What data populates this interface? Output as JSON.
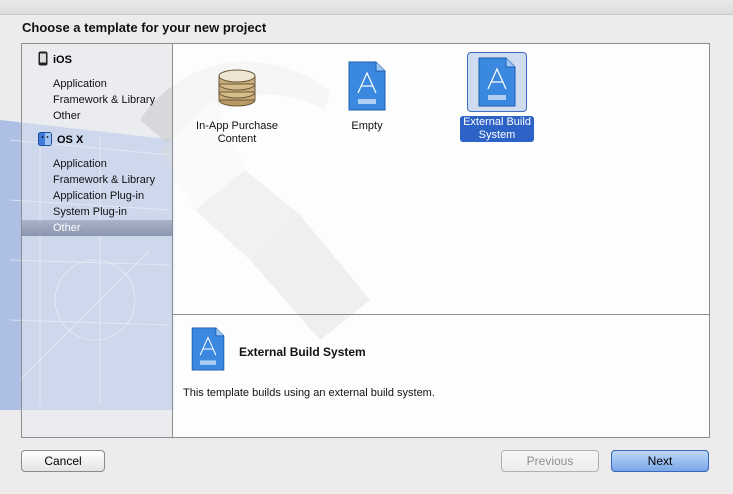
{
  "dialog": {
    "heading": "Choose a template for your new project"
  },
  "sidebar": {
    "groups": [
      {
        "label": "iOS",
        "icon": "iphone-icon",
        "items": [
          "Application",
          "Framework & Library",
          "Other"
        ]
      },
      {
        "label": "OS X",
        "icon": "mac-finder-icon",
        "items": [
          "Application",
          "Framework & Library",
          "Application Plug-in",
          "System Plug-in",
          "Other"
        ]
      }
    ],
    "selected": "OS X / Other"
  },
  "templates": [
    {
      "label_line1": "In-App Purchase",
      "label_line2": "Content",
      "icon": "database-stack-icon",
      "selected": false
    },
    {
      "label_line1": "Empty",
      "label_line2": "",
      "icon": "project-document-icon",
      "selected": false
    },
    {
      "label_line1": "External Build",
      "label_line2": "System",
      "icon": "project-document-icon",
      "selected": true
    }
  ],
  "detail": {
    "title": "External Build System",
    "description": "This template builds using an external build system.",
    "icon": "project-document-icon"
  },
  "buttons": {
    "cancel": "Cancel",
    "previous": "Previous",
    "next": "Next"
  },
  "colors": {
    "selection_blue": "#2d62c6",
    "sidebar_selection": "#8a96b0",
    "blueprint": "#5f83d6"
  }
}
